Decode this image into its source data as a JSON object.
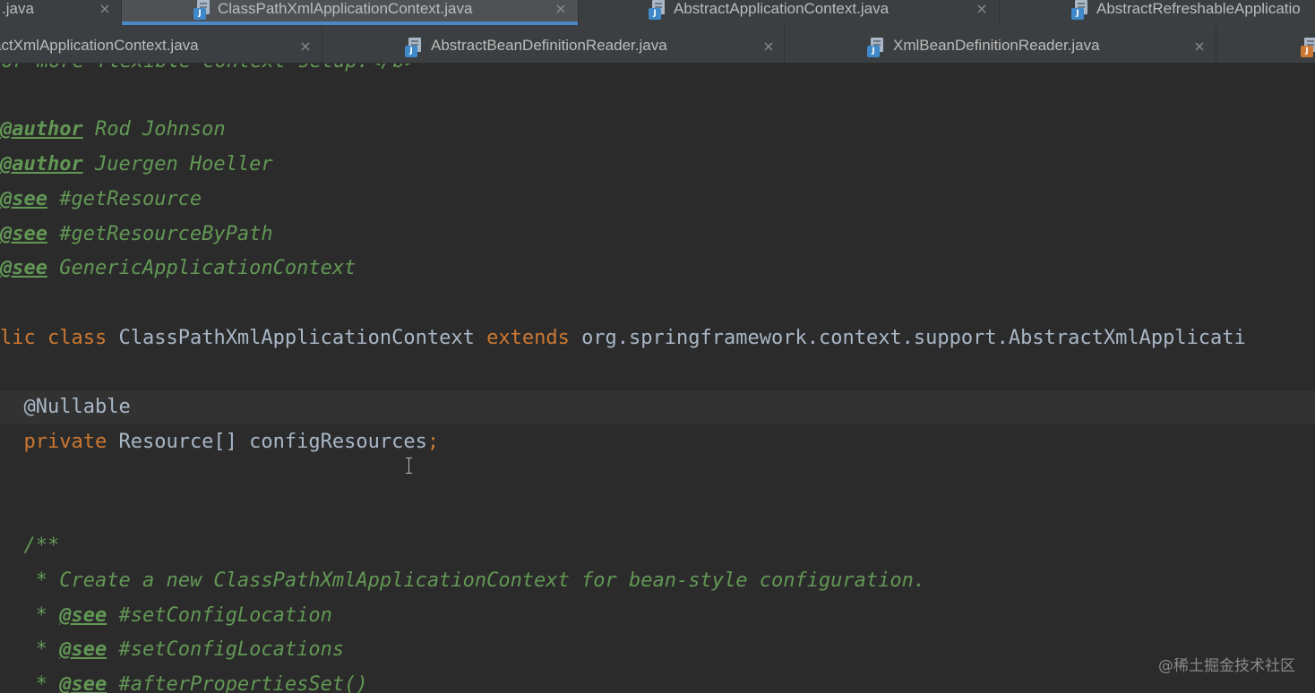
{
  "tabs_row1": [
    {
      "label": ".java",
      "active": false,
      "icon": "java-file-icon"
    },
    {
      "label": "ClassPathXmlApplicationContext.java",
      "active": true,
      "icon": "java-file-icon"
    },
    {
      "label": "AbstractApplicationContext.java",
      "active": false,
      "icon": "java-file-icon"
    },
    {
      "label": "AbstractRefreshableApplicatio",
      "active": false,
      "icon": "java-file-icon"
    }
  ],
  "tabs_row2": [
    {
      "label": "actXmlApplicationContext.java",
      "active": false,
      "icon": "java-file-icon"
    },
    {
      "label": "AbstractBeanDefinitionReader.java",
      "active": false,
      "icon": "java-file-icon"
    },
    {
      "label": "XmlBeanDefinitionReader.java",
      "active": false,
      "icon": "java-file-icon"
    },
    {
      "label": "",
      "active": false,
      "icon": "java-file-icon"
    }
  ],
  "tab_close_glyph": "×",
  "code": {
    "line_flexible": "for more flexible context setup.</b>",
    "author_tag": "@author",
    "author1": "Rod Johnson",
    "author2": "Juergen Hoeller",
    "see_tag": "@see",
    "see1": "#getResource",
    "see2": "#getResourceByPath",
    "see3": "GenericApplicationContext",
    "class_kw1": "lic",
    "class_kw2": "class",
    "class_name": "ClassPathXmlApplicationContext",
    "extends_kw": "extends",
    "superclass": "org.springframework.context.support.AbstractXmlApplicati",
    "annotation": "@Nullable",
    "private_kw": "private",
    "field_type": "Resource[]",
    "field_name": "configResources",
    "semicolon": ";",
    "javadoc_open": "/**",
    "star": "*",
    "javadoc_desc": "Create a new ClassPathXmlApplicationContext for bean-style configuration.",
    "see4": "#setConfigLocation",
    "see5": "#setConfigLocations",
    "see6": "#afterPropertiesSet()"
  },
  "watermark": "@稀土掘金技术社区",
  "colors": {
    "editor_bg": "#2b2b2b",
    "tab_bg": "#3c3f41",
    "active_tab_underline": "#4a88c7",
    "doc_comment": "#629755",
    "keyword": "#cc7832",
    "identifier": "#a9b7c6"
  }
}
